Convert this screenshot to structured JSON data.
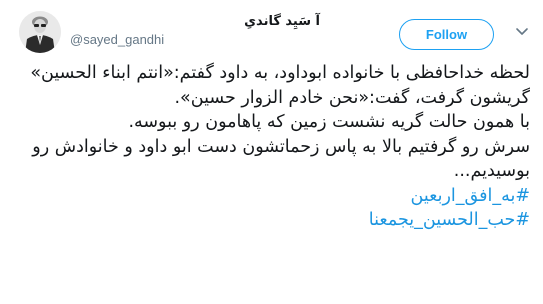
{
  "user": {
    "display_name": "آ سَیِد گاندیِ",
    "handle": "@sayed_gandhi",
    "avatar_icon": "profile-photo-icon"
  },
  "header": {
    "follow_label": "Follow",
    "menu_icon": "chevron-down-icon"
  },
  "tweet": {
    "lines": [
      "لحظه خداحافظی با خانواده ابوداود، به داود گفتم:«انتم ابناء الحسین»",
      "گریشون گرفت، گفت:«نحن خادم الزوار حسین».",
      "با همون حالت گریه نشست زمین که پاهامون رو ببوسه.",
      "سرش رو گرفتیم بالا به پاس زحماتشون دست ابو داود و خانوادش رو بوسیدیم..."
    ],
    "hashtags": [
      "#به_افق_اربعین",
      "#حب_الحسین_یجمعنا"
    ]
  },
  "colors": {
    "brand": "#1da1f2",
    "hashtag": "#1b95e0",
    "text": "#14171a",
    "secondary": "#657786"
  }
}
